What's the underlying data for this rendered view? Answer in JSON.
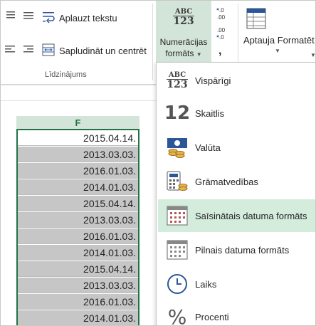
{
  "ribbon": {
    "wrap_text": "Aplauzt tekstu",
    "merge_center": "Sapludināt un centrēt",
    "alignment_group": "Līdzinājums",
    "number_format_line1": "Numerācijas",
    "number_format_line2": "formāts",
    "number_format_icon_top": "ABC",
    "number_format_icon_bottom": "123",
    "conditional_format": "Aptauja Formatēt",
    "comma": ","
  },
  "sheet": {
    "column_header": "F",
    "cells": [
      "2015.04.14.",
      "2013.03.03.",
      "2016.01.03.",
      "2014.01.03.",
      "2015.04.14.",
      "2013.03.03.",
      "2016.01.03.",
      "2014.01.03.",
      "2015.04.14.",
      "2013.03.03.",
      "2016.01.03.",
      "2014.01.03."
    ]
  },
  "dropdown": {
    "items": [
      {
        "label": "Vispārīgi",
        "icon": "general-abc123-icon"
      },
      {
        "label": "Skaitlis",
        "icon": "number-12-icon"
      },
      {
        "label": "Valūta",
        "icon": "currency-icon"
      },
      {
        "label": "Grāmatvedības",
        "icon": "accounting-calculator-icon"
      },
      {
        "label": "Saīsinātais datuma formāts",
        "icon": "short-date-calendar-icon"
      },
      {
        "label": "Pilnais datuma formāts",
        "icon": "long-date-calendar-icon"
      },
      {
        "label": "Laiks",
        "icon": "clock-icon"
      },
      {
        "label": "Procenti",
        "icon": "percent-icon"
      }
    ],
    "icon_text": {
      "abc": "ABC",
      "n123": "123",
      "n12": "12",
      "percent": "%"
    },
    "highlighted_index": 4
  },
  "colors": {
    "accent_green": "#217346",
    "highlight": "#d3ecdc",
    "selection_gray": "#c6c6c6"
  }
}
